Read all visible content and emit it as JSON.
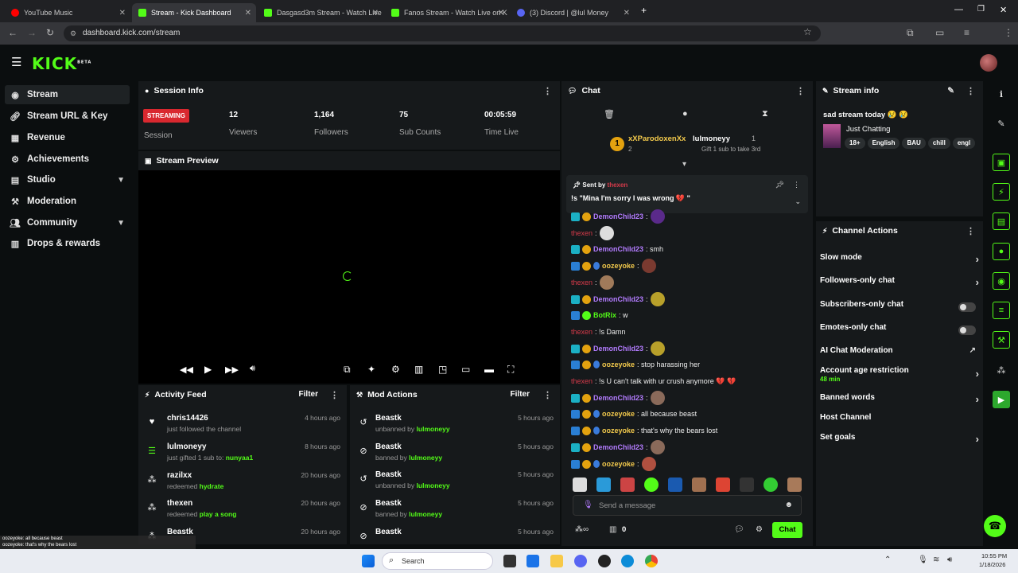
{
  "browser": {
    "tabs": [
      {
        "title": "YouTube Music",
        "active": false
      },
      {
        "title": "Stream - Kick Dashboard",
        "active": true
      },
      {
        "title": "Dasgasd3m Stream - Watch Live",
        "active": false
      },
      {
        "title": "Fanos Stream - Watch Live on K",
        "active": false
      },
      {
        "title": "(3) Discord | @lul Money",
        "active": false
      }
    ],
    "url": "dashboard.kick.com/stream"
  },
  "header": {
    "logo": "KICK",
    "beta": "BETA"
  },
  "sidebar": {
    "items": [
      {
        "label": "Stream",
        "icon": "broadcast-icon"
      },
      {
        "label": "Stream URL & Key",
        "icon": "link-icon"
      },
      {
        "label": "Revenue",
        "icon": "revenue-icon"
      },
      {
        "label": "Achievements",
        "icon": "gear-icon"
      },
      {
        "label": "Studio",
        "icon": "grid-icon"
      },
      {
        "label": "Moderation",
        "icon": "hammer-icon"
      },
      {
        "label": "Community",
        "icon": "people-icon"
      },
      {
        "label": "Drops & rewards",
        "icon": "gift-icon"
      }
    ]
  },
  "session": {
    "title": "Session Info",
    "status": "STREAMING",
    "status_label": "Session",
    "stats": [
      {
        "value": "12",
        "label": "Viewers"
      },
      {
        "value": "1,164",
        "label": "Followers"
      },
      {
        "value": "75",
        "label": "Sub Counts"
      },
      {
        "value": "00:05:59",
        "label": "Time Live"
      }
    ]
  },
  "preview": {
    "title": "Stream Preview"
  },
  "activity": {
    "title": "Activity Feed",
    "filter": "Filter",
    "items": [
      {
        "name": "chris14426",
        "sub_pre": "just followed the channel",
        "sub_hl": "",
        "time": "4 hours ago",
        "icon": "heart-icon"
      },
      {
        "name": "lulmoneyy",
        "sub_pre": "just gifted 1 sub to: ",
        "sub_hl": "nunyaa1",
        "time": "8 hours ago",
        "icon": "gift-sub-icon"
      },
      {
        "name": "razilxx",
        "sub_pre": "redeemed ",
        "sub_hl": "hydrate",
        "time": "20 hours ago",
        "icon": "points-icon"
      },
      {
        "name": "thexen",
        "sub_pre": "redeemed ",
        "sub_hl": "play a song",
        "time": "20 hours ago",
        "icon": "points-icon"
      },
      {
        "name": "Beastk",
        "sub_pre": "",
        "sub_hl": "",
        "time": "20 hours ago",
        "icon": "points-icon"
      }
    ]
  },
  "mod_actions": {
    "title": "Mod Actions",
    "filter": "Filter",
    "items": [
      {
        "name": "Beastk",
        "action": "unbanned by ",
        "by": "lulmoneyy",
        "time": "5 hours ago",
        "icon": "unban-icon"
      },
      {
        "name": "Beastk",
        "action": "banned by ",
        "by": "lulmoneyy",
        "time": "5 hours ago",
        "icon": "ban-icon"
      },
      {
        "name": "Beastk",
        "action": "unbanned by ",
        "by": "lulmoneyy",
        "time": "5 hours ago",
        "icon": "unban-icon"
      },
      {
        "name": "Beastk",
        "action": "banned by ",
        "by": "lulmoneyy",
        "time": "5 hours ago",
        "icon": "ban-icon"
      },
      {
        "name": "Beastk",
        "action": "",
        "by": "",
        "time": "5 hours ago",
        "icon": "ban-icon"
      }
    ]
  },
  "chat": {
    "title": "Chat",
    "leader1": "xXParodoxenXx",
    "leader1_count": "2",
    "leader1_rank": "1",
    "leader2": "lulmoneyy",
    "leader2_count": "1",
    "leader2_sub": "Gift 1 sub to take 3rd",
    "pinned_by_label": "Sent by",
    "pinned_by": "thexen",
    "pinned_text": "!s \"Mina I'm sorry I was wrong 💔 \"",
    "messages": [
      {
        "user": "DemonChild23",
        "cls": "u-demon",
        "badges": [
          "teal",
          "gold"
        ],
        "text": ":",
        "emote": "#5a2a8a"
      },
      {
        "user": "thexen",
        "cls": "u-thex",
        "badges": [],
        "text": ":",
        "emote": "#ddd"
      },
      {
        "user": "DemonChild23",
        "cls": "u-demon",
        "badges": [
          "teal",
          "gold"
        ],
        "text": ": smh",
        "emote": ""
      },
      {
        "user": "oozeyoke",
        "cls": "u-ooz",
        "badges": [
          "mod",
          "gold",
          "sub"
        ],
        "text": ":",
        "emote": "#7a3a30"
      },
      {
        "user": "thexen",
        "cls": "u-thex",
        "badges": [],
        "text": ":",
        "emote": "#a07a5a"
      },
      {
        "user": "DemonChild23",
        "cls": "u-demon",
        "badges": [
          "teal",
          "gold"
        ],
        "text": ":",
        "emote": "#b8a02a"
      },
      {
        "user": "BotRix",
        "cls": "u-bot",
        "badges": [
          "mod",
          "verified"
        ],
        "text": ": w",
        "emote": ""
      },
      {
        "user": "thexen",
        "cls": "u-thex",
        "badges": [],
        "text": ": !s Damn",
        "emote": ""
      },
      {
        "user": "DemonChild23",
        "cls": "u-demon",
        "badges": [
          "teal",
          "gold"
        ],
        "text": ":",
        "emote": "#b8a02a"
      },
      {
        "user": "oozeyoke",
        "cls": "u-ooz",
        "badges": [
          "mod",
          "gold",
          "sub"
        ],
        "text": ": stop harassing her",
        "emote": ""
      },
      {
        "user": "thexen",
        "cls": "u-thex",
        "badges": [],
        "text": ": !s U can't talk with ur crush anymore 💔 💔",
        "emote": ""
      },
      {
        "user": "DemonChild23",
        "cls": "u-demon",
        "badges": [
          "teal",
          "gold"
        ],
        "text": ":",
        "emote": "#8a6a5a"
      },
      {
        "user": "oozeyoke",
        "cls": "u-ooz",
        "badges": [
          "mod",
          "gold",
          "sub"
        ],
        "text": ": all because beast",
        "emote": ""
      },
      {
        "user": "oozeyoke",
        "cls": "u-ooz",
        "badges": [
          "mod",
          "gold",
          "sub"
        ],
        "text": ": that's why the bears lost",
        "emote": ""
      },
      {
        "user": "DemonChild23",
        "cls": "u-demon",
        "badges": [
          "teal",
          "gold"
        ],
        "text": ":",
        "emote": "#8a6a5a"
      },
      {
        "user": "oozeyoke",
        "cls": "u-ooz",
        "badges": [
          "mod",
          "gold",
          "sub"
        ],
        "text": ":",
        "emote": "#b05040"
      }
    ],
    "input_placeholder": "Send a message",
    "points": "0",
    "send": "Chat"
  },
  "stream_info": {
    "title": "Stream info",
    "stream_title": "sad stream today 😢 😢",
    "category": "Just Chatting",
    "tags": [
      "18+",
      "English",
      "BAU",
      "chill",
      "engl"
    ]
  },
  "channel_actions": {
    "title": "Channel Actions",
    "items": [
      {
        "label": "Slow mode",
        "type": "arrow",
        "sub": ""
      },
      {
        "label": "Followers-only chat",
        "type": "arrow",
        "sub": ""
      },
      {
        "label": "Subscribers-only chat",
        "type": "toggle",
        "sub": ""
      },
      {
        "label": "Emotes-only chat",
        "type": "toggle",
        "sub": ""
      },
      {
        "label": "AI Chat Moderation",
        "type": "external",
        "sub": ""
      },
      {
        "label": "Account age restriction",
        "type": "arrow",
        "sub": "48 min"
      },
      {
        "label": "Banned words",
        "type": "arrow",
        "sub": ""
      },
      {
        "label": "Host Channel",
        "type": "none",
        "sub": ""
      },
      {
        "label": "Set goals",
        "type": "arrow",
        "sub": ""
      }
    ]
  },
  "overlay_chat": [
    "oozeyoke: all because beast",
    "oozeyoke: that's why the bears lost"
  ],
  "taskbar": {
    "search": "Search",
    "time": "10:55 PM",
    "date": "1/18/2026"
  },
  "colors": {
    "accent": "#53fc18",
    "live": "#d9282f",
    "panel": "#16191b",
    "bg": "#0b0e0f"
  }
}
